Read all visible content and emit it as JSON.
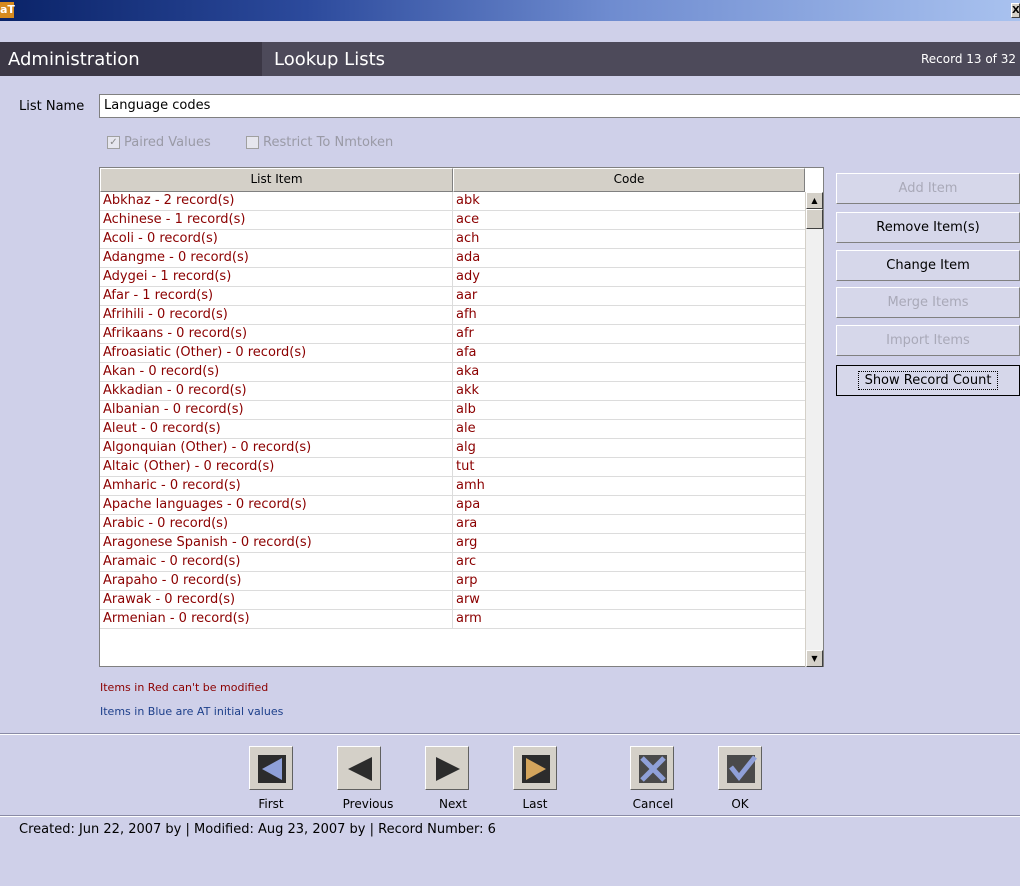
{
  "window": {
    "logo": "aT",
    "close_glyph": "X"
  },
  "header": {
    "module": "Administration",
    "screen": "Lookup Lists",
    "record_position": "Record 13 of 32"
  },
  "list_name": {
    "label": "List Name",
    "value": "Language codes"
  },
  "options": {
    "paired_values": {
      "label": "Paired Values",
      "checked": true
    },
    "restrict_nmtoken": {
      "label": "Restrict To Nmtoken",
      "checked": false
    }
  },
  "grid": {
    "columns": [
      "List Item",
      "Code"
    ],
    "rows": [
      [
        "Abkhaz - 2 record(s)",
        "abk"
      ],
      [
        "Achinese - 1 record(s)",
        "ace"
      ],
      [
        "Acoli - 0 record(s)",
        "ach"
      ],
      [
        "Adangme - 0 record(s)",
        "ada"
      ],
      [
        "Adygei - 1 record(s)",
        "ady"
      ],
      [
        "Afar - 1 record(s)",
        "aar"
      ],
      [
        "Afrihili - 0 record(s)",
        "afh"
      ],
      [
        "Afrikaans - 0 record(s)",
        "afr"
      ],
      [
        "Afroasiatic (Other) - 0 record(s)",
        "afa"
      ],
      [
        "Akan - 0 record(s)",
        "aka"
      ],
      [
        "Akkadian - 0 record(s)",
        "akk"
      ],
      [
        "Albanian - 0 record(s)",
        "alb"
      ],
      [
        "Aleut - 0 record(s)",
        "ale"
      ],
      [
        "Algonquian (Other) - 0 record(s)",
        "alg"
      ],
      [
        "Altaic (Other) - 0 record(s)",
        "tut"
      ],
      [
        "Amharic - 0 record(s)",
        "amh"
      ],
      [
        "Apache languages - 0 record(s)",
        "apa"
      ],
      [
        "Arabic - 0 record(s)",
        "ara"
      ],
      [
        "Aragonese Spanish - 0 record(s)",
        "arg"
      ],
      [
        "Aramaic - 0 record(s)",
        "arc"
      ],
      [
        "Arapaho - 0 record(s)",
        "arp"
      ],
      [
        "Arawak - 0 record(s)",
        "arw"
      ],
      [
        "Armenian - 0 record(s)",
        "arm"
      ]
    ],
    "row_text_color": "#8b0000"
  },
  "side_buttons": [
    {
      "label": "Add Item",
      "enabled": false,
      "focused": false
    },
    {
      "label": "Remove Item(s)",
      "enabled": true,
      "focused": false
    },
    {
      "label": "Change Item",
      "enabled": true,
      "focused": false
    },
    {
      "label": "Merge Items",
      "enabled": false,
      "focused": false
    },
    {
      "label": "Import Items",
      "enabled": false,
      "focused": false
    },
    {
      "label": "Show Record Count",
      "enabled": true,
      "focused": true
    }
  ],
  "legend": {
    "red_note": "Items in Red can't be modified",
    "blue_note": "Items in Blue are AT initial values"
  },
  "navigation": {
    "first": "First",
    "previous": "Previous",
    "next": "Next",
    "last": "Last",
    "cancel": "Cancel",
    "ok": "OK"
  },
  "status": {
    "text": "Created: Jun 22, 2007 by  | Modified: Aug 23, 2007 by  | Record Number: 6"
  },
  "colors": {
    "background": "#cfd0e9",
    "header_bar": "#4d4a5a",
    "red_text": "#8b0000",
    "blue_text": "#1d3f8a"
  }
}
